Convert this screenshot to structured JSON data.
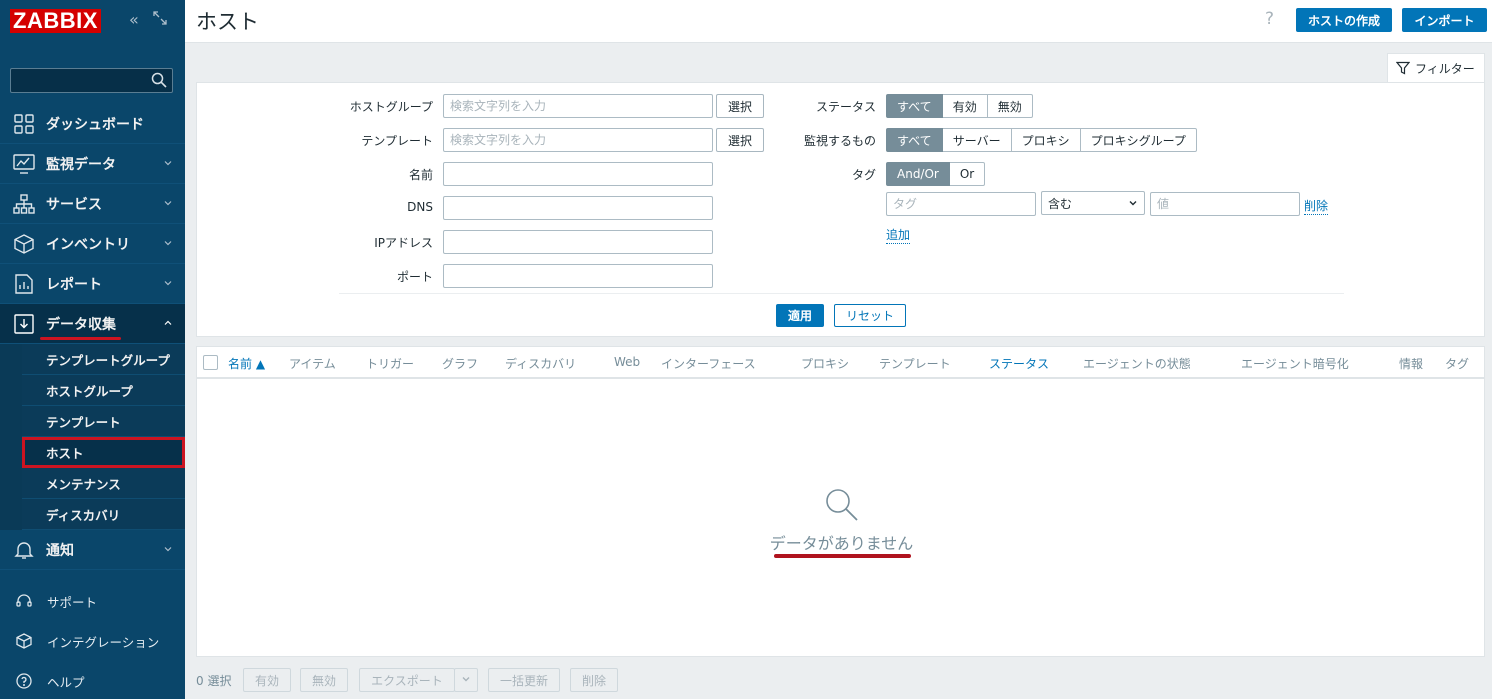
{
  "sidebar": {
    "logo": "ZABBIX",
    "menu": [
      {
        "label": "ダッシュボード"
      },
      {
        "label": "監視データ"
      },
      {
        "label": "サービス"
      },
      {
        "label": "インベントリ"
      },
      {
        "label": "レポート"
      },
      {
        "label": "データ収集"
      }
    ],
    "submenu": [
      "テンプレートグループ",
      "ホストグループ",
      "テンプレート",
      "ホスト",
      "メンテナンス",
      "ディスカバリ"
    ],
    "notify": "通知",
    "bottom": [
      "サポート",
      "インテグレーション",
      "ヘルプ"
    ]
  },
  "header": {
    "title": "ホスト",
    "help": "?",
    "create_host": "ホストの作成",
    "import": "インポート"
  },
  "filter": {
    "tab_label": "フィルター",
    "host_group_label": "ホストグループ",
    "template_label": "テンプレート",
    "name_label": "名前",
    "dns_label": "DNS",
    "ip_label": "IPアドレス",
    "port_label": "ポート",
    "search_placeholder": "検索文字列を入力",
    "select": "選択",
    "status_label": "ステータス",
    "status_options": [
      "すべて",
      "有効",
      "無効"
    ],
    "monitored_label": "監視するもの",
    "monitored_options": [
      "すべて",
      "サーバー",
      "プロキシ",
      "プロキシグループ"
    ],
    "tag_label": "タグ",
    "tag_logic": [
      "And/Or",
      "Or"
    ],
    "tag_placeholder": "タグ",
    "tag_operator": "含む",
    "tag_value_placeholder": "値",
    "remove": "削除",
    "add": "追加",
    "apply": "適用",
    "reset": "リセット"
  },
  "table": {
    "columns": [
      "名前 ▲",
      "アイテム",
      "トリガー",
      "グラフ",
      "ディスカバリ",
      "Web",
      "インターフェース",
      "プロキシ",
      "テンプレート",
      "ステータス",
      "エージェントの状態",
      "エージェント暗号化",
      "情報",
      "タグ"
    ],
    "empty": "データがありません"
  },
  "footer": {
    "selected": "0 選択",
    "enable": "有効",
    "disable": "無効",
    "export": "エクスポート",
    "mass_update": "一括更新",
    "delete": "削除"
  }
}
